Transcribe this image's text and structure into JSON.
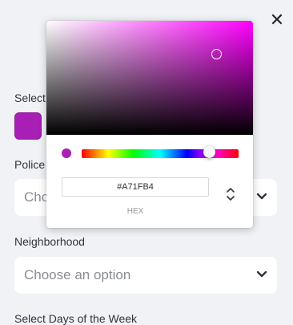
{
  "close": {
    "glyph": "✕"
  },
  "labels": {
    "select": "Select",
    "police": "Police",
    "neighborhood": "Neighborhood",
    "days": "Select Days of the Week"
  },
  "color_swatch": {
    "color": "#A71FB4"
  },
  "police_select": {
    "placeholder": "Choose an option"
  },
  "neighborhood_select": {
    "placeholder": "Choose an option"
  },
  "picker": {
    "hue_color": "#ff00ff",
    "current_color": "#A71FB4",
    "hex_value": "#A71FB4",
    "format_label": "HEX"
  },
  "icons": {
    "close": "close-icon",
    "chevron": "chevron-down-icon",
    "format_toggle": "up-down-arrows-icon"
  }
}
